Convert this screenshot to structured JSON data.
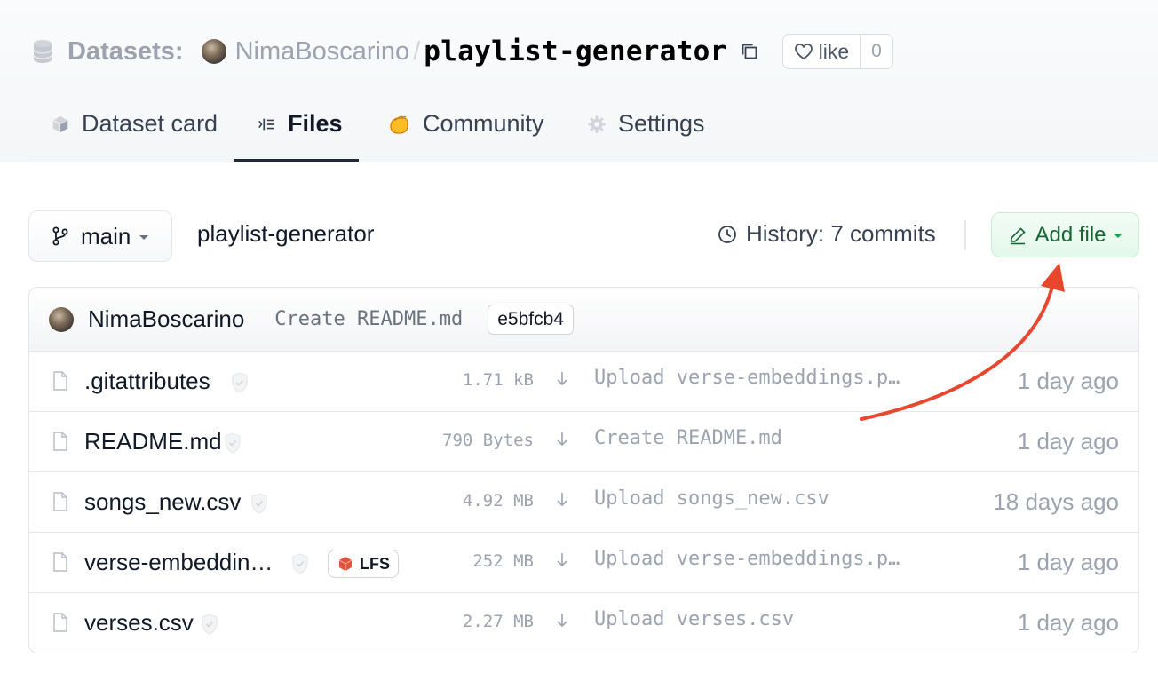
{
  "breadcrumb": {
    "section": "Datasets:",
    "owner": "NimaBoscarino",
    "separator": "/",
    "repo": "playlist-generator"
  },
  "like": {
    "label": "like",
    "count": "0"
  },
  "tabs": [
    {
      "label": "Dataset card",
      "icon": "cube-icon"
    },
    {
      "label": "Files",
      "icon": "files-icon",
      "active": true
    },
    {
      "label": "Community",
      "icon": "community-icon"
    },
    {
      "label": "Settings",
      "icon": "gear-icon"
    }
  ],
  "toolbar": {
    "branch": "main",
    "path": "playlist-generator",
    "history": "History: 7 commits",
    "add_file": "Add file"
  },
  "last_commit": {
    "author": "NimaBoscarino",
    "message": "Create README.md",
    "hash": "e5bfcb4"
  },
  "files": [
    {
      "name": ".gitattributes",
      "size": "1.71 kB",
      "message": "Upload verse-embeddings.p…",
      "date": "1 day ago",
      "lfs": false
    },
    {
      "name": "README.md",
      "size": "790 Bytes",
      "message": "Create README.md",
      "date": "1 day ago",
      "lfs": false
    },
    {
      "name": "songs_new.csv",
      "size": "4.92 MB",
      "message": "Upload songs_new.csv",
      "date": "18 days ago",
      "lfs": false
    },
    {
      "name": "verse-embeddin…",
      "size": "252 MB",
      "message": "Upload verse-embeddings.p…",
      "date": "1 day ago",
      "lfs": true,
      "lfs_label": "LFS"
    },
    {
      "name": "verses.csv",
      "size": "2.27 MB",
      "message": "Upload verses.csv",
      "date": "1 day ago",
      "lfs": false
    }
  ],
  "colors": {
    "add_file_bg": "#e4f8eb",
    "add_file_text": "#166534",
    "annotation_arrow": "#e8472e",
    "lfs_icon": "#e0533d"
  }
}
